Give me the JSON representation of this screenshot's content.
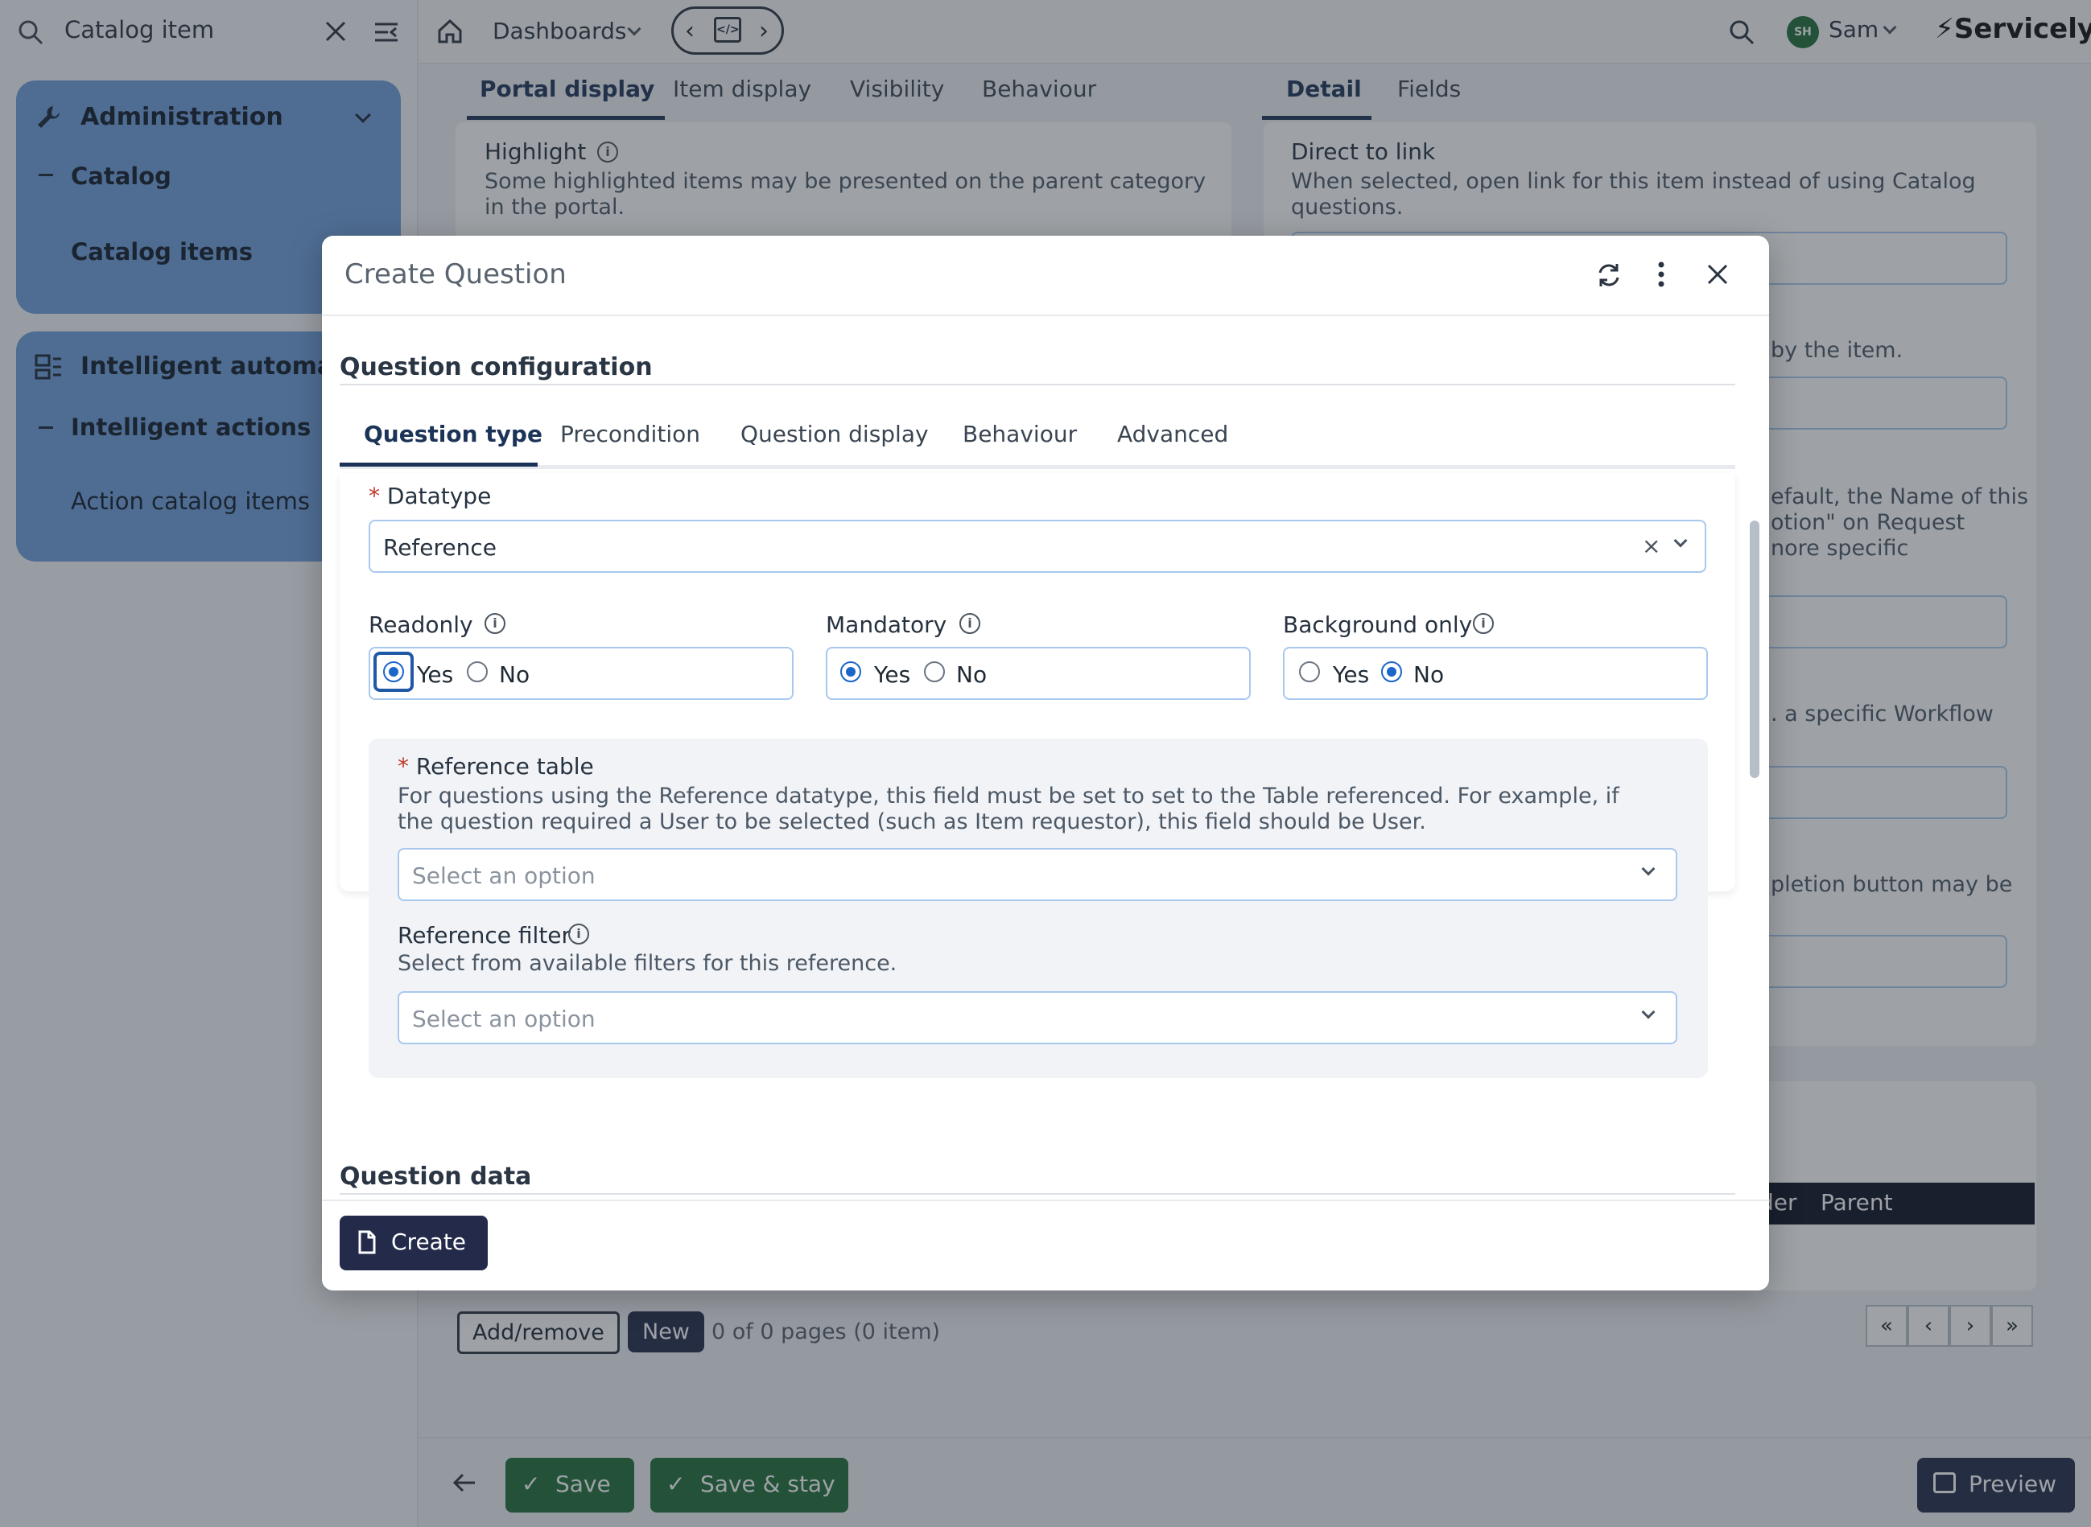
{
  "search": {
    "value": "Catalog item"
  },
  "nav": {
    "admin_title": "Administration",
    "catalog": "Catalog",
    "catalog_items": "Catalog items",
    "intelligent_title": "Intelligent automatio",
    "intelligent_actions": "Intelligent actions",
    "action_catalog_items": "Action catalog items"
  },
  "topbar": {
    "dashboards": "Dashboards",
    "avatar_initials": "SH",
    "user": "Sam",
    "brand": "Servicely"
  },
  "bg": {
    "left_tabs": [
      "Portal display",
      "Item display",
      "Visibility",
      "Behaviour"
    ],
    "right_tabs": [
      "Detail",
      "Fields"
    ],
    "highlight_label": "Highlight",
    "highlight_help": "Some highlighted items may be presented on the parent category in the portal.",
    "direct_label": "Direct to link",
    "direct_help": "When selected, open link for this item instead of using Catalog questions.",
    "frag1": "by the item.",
    "frag2": "efault, the Name of this",
    "frag3": "otion\" on Request",
    "frag4": "nore specific",
    "frag5": ". a specific Workflow",
    "frag6": "pletion button may be",
    "table_col1": "der",
    "table_col2": "Parent",
    "add_remove": "Add/remove",
    "new": "New",
    "pages": "0 of 0 pages (0 item)",
    "save": "Save",
    "save_stay": "Save & stay",
    "preview": "Preview"
  },
  "modal": {
    "title": "Create Question",
    "section": "Question configuration",
    "tabs": [
      "Question type",
      "Precondition",
      "Question display",
      "Behaviour",
      "Advanced"
    ],
    "datatype_label": "Datatype",
    "datatype_value": "Reference",
    "readonly": "Readonly",
    "mandatory": "Mandatory",
    "background_only": "Background only",
    "yes": "Yes",
    "no": "No",
    "ref_table_label": "Reference table",
    "ref_table_help": "For questions using the Reference datatype, this field must be set to set to the Table referenced. For example, if the question required a User to be selected (such as Item requestor), this field should be User.",
    "ref_filter_label": "Reference filter",
    "ref_filter_help": "Select from available filters for this reference.",
    "placeholder": "Select an option",
    "question_data": "Question data",
    "create": "Create"
  },
  "colors": {
    "accent": "#1b66c9",
    "nav": "#6f9fdc",
    "dark_button": "#232a4a",
    "green_button": "#1f6e3a"
  }
}
